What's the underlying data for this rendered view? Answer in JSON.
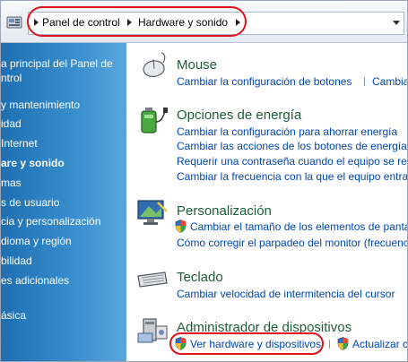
{
  "breadcrumb": {
    "items": [
      "Panel de control",
      "Hardware y sonido"
    ]
  },
  "sidebar": {
    "items": [
      {
        "label": "a principal del Panel de",
        "bold": false
      },
      {
        "label": "ntrol",
        "bold": false
      },
      {
        "label": "y mantenimiento",
        "bold": false
      },
      {
        "label": "idad",
        "bold": false
      },
      {
        "label": "Internet",
        "bold": false
      },
      {
        "label": "are y sonido",
        "bold": true
      },
      {
        "label": "mas",
        "bold": false
      },
      {
        "label": "s de usuario",
        "bold": false
      },
      {
        "label": "cia y personalización",
        "bold": false
      },
      {
        "label": "dioma y región",
        "bold": false
      },
      {
        "label": "bilidad",
        "bold": false
      },
      {
        "label": "es adicionales",
        "bold": false
      },
      {
        "label": "ásica",
        "bold": false
      }
    ]
  },
  "categories": {
    "mouse": {
      "title": "Mouse",
      "links": [
        "Cambiar la configuración de botones",
        "Cambia"
      ]
    },
    "energy": {
      "title": "Opciones de energía",
      "links": [
        "Cambiar la configuración para ahorrar energía",
        "Cambiar las acciones de los botones de energía",
        "Requerir una contraseña cuando el equipo se reac",
        "Cambiar la frecuencia con la que el equipo entra"
      ]
    },
    "personalization": {
      "title": "Personalización",
      "links": [
        "Cambiar el tamaño de los elementos de panta",
        "Cómo corregir el parpadeo del monitor (frecuenc"
      ]
    },
    "keyboard": {
      "title": "Teclado",
      "links": [
        "Cambiar velocidad de intermitencia del cursor"
      ]
    },
    "devices": {
      "title": "Administrador de dispositivos",
      "links": [
        "Ver hardware y dispositivos",
        "Actualizar c"
      ]
    }
  },
  "colors": {
    "accent_link": "#0046b4",
    "category_title": "#1e5d3a",
    "sidebar": "#3a8fcf",
    "highlight_ring": "#e0121c"
  }
}
